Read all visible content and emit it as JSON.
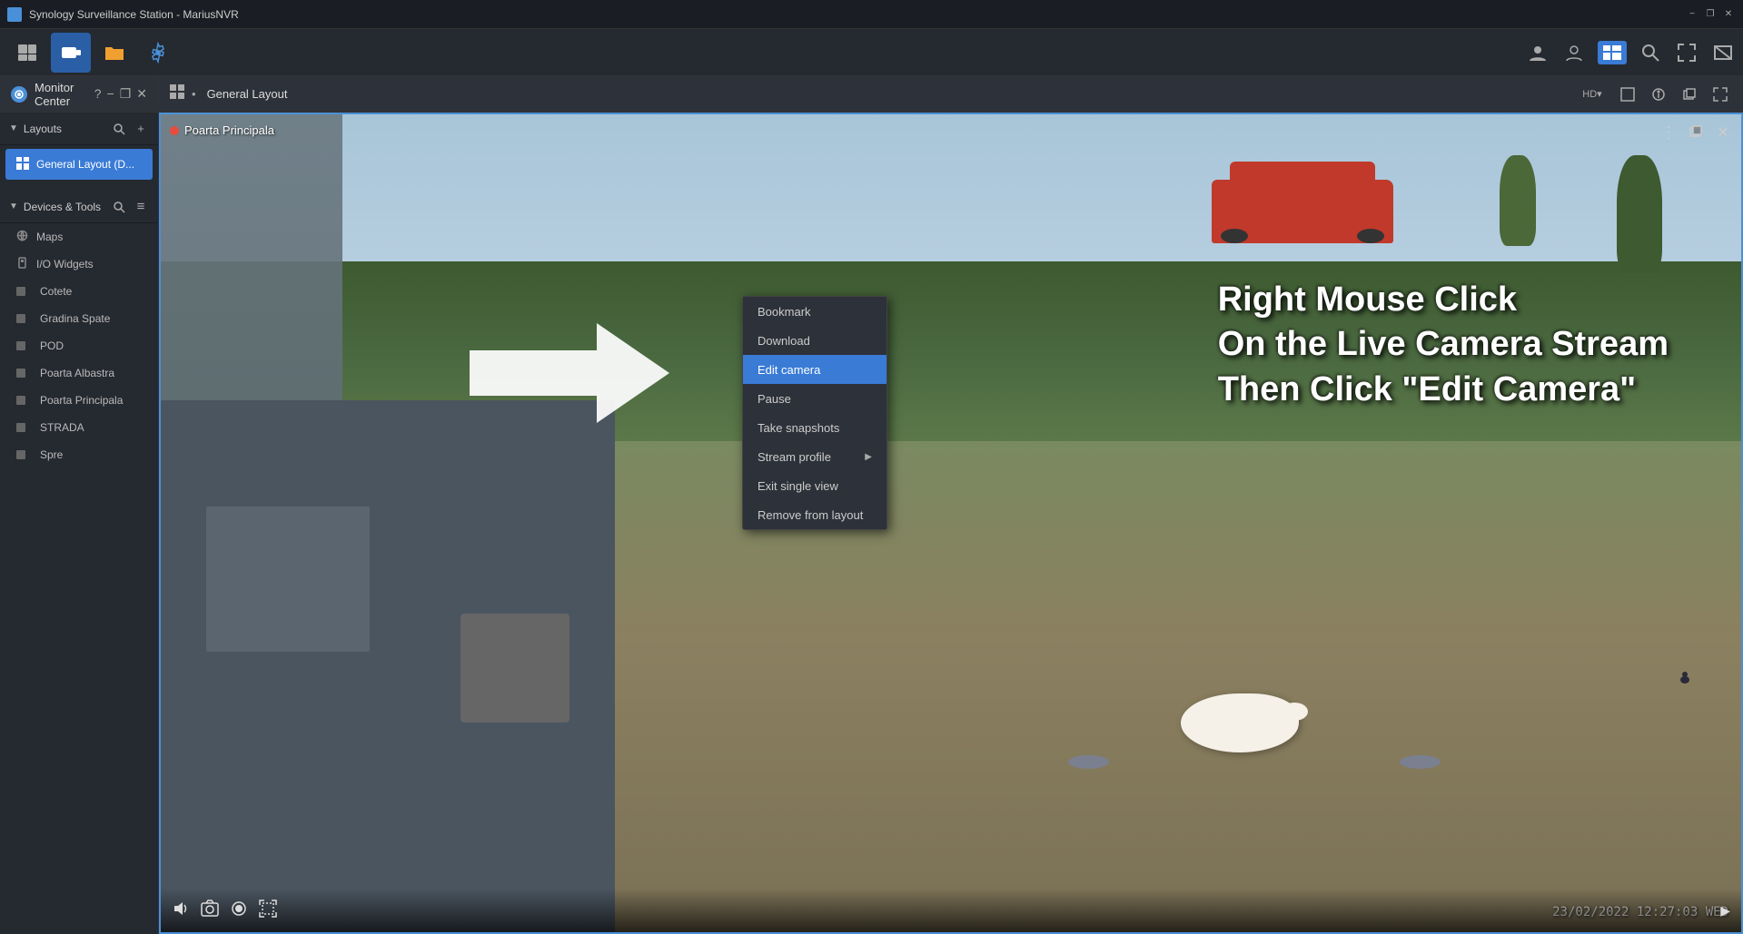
{
  "app": {
    "title": "Synology Surveillance Station - MariusNVR",
    "minimize_label": "−",
    "maximize_label": "□",
    "close_label": "✕",
    "restore_label": "❐"
  },
  "toolbar": {
    "icons": [
      "monitor",
      "camera",
      "folder",
      "settings"
    ],
    "right_icons": [
      "avatar",
      "user",
      "layout",
      "search",
      "fullscreen",
      "expand"
    ]
  },
  "monitor_center": {
    "title": "Monitor Center",
    "help_label": "?",
    "minimize_label": "−",
    "restore_label": "❐",
    "close_label": "✕"
  },
  "sidebar": {
    "layouts_section": {
      "title": "Layouts",
      "search_icon": "🔍",
      "add_icon": "+"
    },
    "layout_item": {
      "label": "General Layout (D..."
    },
    "devices_section": {
      "title": "Devices & Tools",
      "search_icon": "🔍",
      "menu_icon": "≡"
    },
    "devices": [
      {
        "label": "Maps",
        "icon": "globe",
        "color": "#888"
      },
      {
        "label": "I/O Widgets",
        "icon": "lock",
        "color": "#888"
      },
      {
        "label": "Cotete",
        "icon": "square",
        "color": "#666"
      },
      {
        "label": "Gradina Spate",
        "icon": "square",
        "color": "#666"
      },
      {
        "label": "POD",
        "icon": "square",
        "color": "#666"
      },
      {
        "label": "Poarta Albastra",
        "icon": "square",
        "color": "#666"
      },
      {
        "label": "Poarta Principala",
        "icon": "square",
        "color": "#666"
      },
      {
        "label": "STRADA",
        "icon": "square",
        "color": "#666"
      },
      {
        "label": "Spre",
        "icon": "square",
        "color": "#666"
      }
    ]
  },
  "layout_header": {
    "title": "General Layout",
    "quality_btn": "HD▾",
    "fullscreen_btn": "⛶",
    "info_btn": "ℹ",
    "window_btn": "⧉",
    "expand_btn": "⤢"
  },
  "camera": {
    "name": "Poarta Principala",
    "status": "live",
    "timestamp": "23/02/2022  12:27:03  WED",
    "controls": {
      "volume": "🔈",
      "snapshot": "📷",
      "record": "⏺",
      "fullscreen": "⛶",
      "arrow": "▶"
    }
  },
  "context_menu": {
    "items": [
      {
        "label": "Bookmark",
        "has_submenu": false
      },
      {
        "label": "Download",
        "has_submenu": false
      },
      {
        "label": "Edit camera",
        "has_submenu": false
      },
      {
        "label": "Pause",
        "has_submenu": false
      },
      {
        "label": "Take snapshots",
        "has_submenu": false
      },
      {
        "label": "Stream profile",
        "has_submenu": true
      },
      {
        "label": "Exit single view",
        "has_submenu": false
      },
      {
        "label": "Remove from layout",
        "has_submenu": false
      }
    ]
  },
  "overlay": {
    "line1": "Right Mouse Click",
    "line2": "On the Live Camera Stream",
    "line3": "Then Click \"Edit Camera\""
  }
}
